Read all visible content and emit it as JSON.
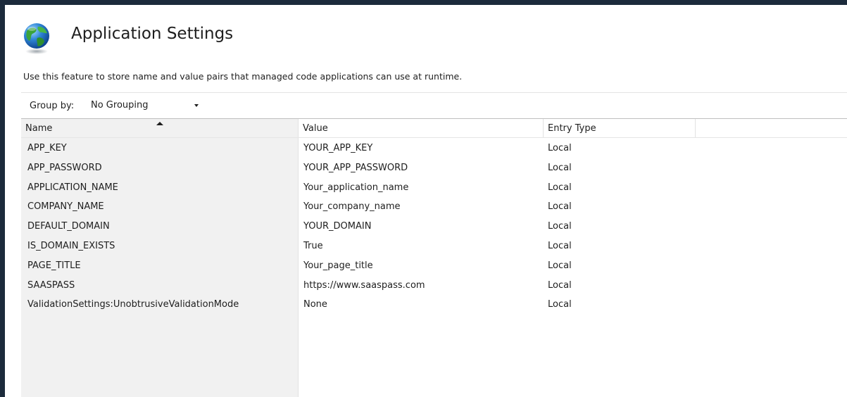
{
  "header": {
    "title": "Application Settings",
    "icon": "globe-icon",
    "description": "Use this feature to store name and value pairs that managed code applications can use at runtime."
  },
  "toolbar": {
    "group_by_label": "Group by:",
    "group_by_value": "No Grouping"
  },
  "grid": {
    "columns": [
      "Name",
      "Value",
      "Entry Type"
    ],
    "sorted_column": "Name",
    "sort_direction": "ascending",
    "rows": [
      {
        "name": "APP_KEY",
        "value": "YOUR_APP_KEY",
        "entry_type": "Local"
      },
      {
        "name": "APP_PASSWORD",
        "value": "YOUR_APP_PASSWORD",
        "entry_type": "Local"
      },
      {
        "name": "APPLICATION_NAME",
        "value": "Your_application_name",
        "entry_type": "Local"
      },
      {
        "name": "COMPANY_NAME",
        "value": "Your_company_name",
        "entry_type": "Local"
      },
      {
        "name": "DEFAULT_DOMAIN",
        "value": "YOUR_DOMAIN",
        "entry_type": "Local"
      },
      {
        "name": "IS_DOMAIN_EXISTS",
        "value": "True",
        "entry_type": "Local"
      },
      {
        "name": "PAGE_TITLE",
        "value": "Your_page_title",
        "entry_type": "Local"
      },
      {
        "name": "SAASPASS",
        "value": "https://www.saaspass.com",
        "entry_type": "Local"
      },
      {
        "name": "ValidationSettings:UnobtrusiveValidationMode",
        "value": "None",
        "entry_type": "Local"
      }
    ]
  },
  "colors": {
    "frame": "#1c2b3c",
    "name_column_shade": "#f1f1f1",
    "text": "#1e1e1e"
  }
}
